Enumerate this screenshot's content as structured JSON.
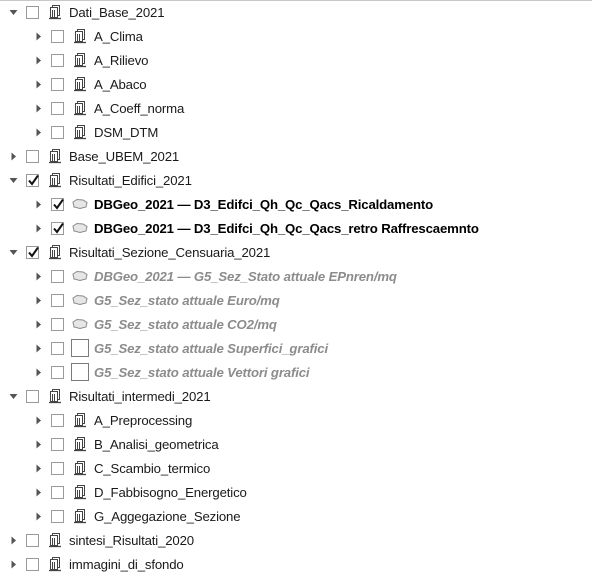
{
  "tree": [
    {
      "label": "Dati_Base_2021",
      "level": 0,
      "expander": "expanded",
      "checked": false,
      "icon": "group-icon",
      "style": "normal"
    },
    {
      "label": "A_Clima",
      "level": 1,
      "expander": "collapsed",
      "checked": false,
      "icon": "group-icon",
      "style": "normal"
    },
    {
      "label": "A_Rilievo",
      "level": 1,
      "expander": "collapsed",
      "checked": false,
      "icon": "group-icon",
      "style": "normal"
    },
    {
      "label": "A_Abaco",
      "level": 1,
      "expander": "collapsed",
      "checked": false,
      "icon": "group-icon",
      "style": "normal"
    },
    {
      "label": "A_Coeff_norma",
      "level": 1,
      "expander": "collapsed",
      "checked": false,
      "icon": "group-icon",
      "style": "normal"
    },
    {
      "label": "DSM_DTM",
      "level": 1,
      "expander": "collapsed",
      "checked": false,
      "icon": "group-icon",
      "style": "normal"
    },
    {
      "label": "Base_UBEM_2021",
      "level": 0,
      "expander": "collapsed",
      "checked": false,
      "icon": "group-icon",
      "style": "normal"
    },
    {
      "label": "Risultati_Edifici_2021",
      "level": 0,
      "expander": "expanded",
      "checked": true,
      "icon": "group-icon",
      "style": "normal"
    },
    {
      "label": "DBGeo_2021 — D3_Edifci_Qh_Qc_Qacs_Ricaldamento",
      "level": 1,
      "expander": "collapsed",
      "checked": true,
      "icon": "polygon-layer-icon",
      "style": "bold"
    },
    {
      "label": "DBGeo_2021 — D3_Edifci_Qh_Qc_Qacs_retro  Raffrescaemnto",
      "level": 1,
      "expander": "collapsed",
      "checked": true,
      "icon": "polygon-layer-icon",
      "style": "bold"
    },
    {
      "label": "Risultati_Sezione_Censuaria_2021",
      "level": 0,
      "expander": "expanded",
      "checked": true,
      "icon": "group-icon",
      "style": "normal"
    },
    {
      "label": "DBGeo_2021 — G5_Sez_Stato attuale EPnren/mq",
      "level": 1,
      "expander": "collapsed",
      "checked": false,
      "icon": "polygon-layer-icon",
      "style": "dim"
    },
    {
      "label": "G5_Sez_stato attuale Euro/mq",
      "level": 1,
      "expander": "collapsed",
      "checked": false,
      "icon": "polygon-layer-icon",
      "style": "dim"
    },
    {
      "label": "G5_Sez_stato attuale  CO2/mq",
      "level": 1,
      "expander": "collapsed",
      "checked": false,
      "icon": "polygon-layer-icon",
      "style": "dim"
    },
    {
      "label": "G5_Sez_stato attuale  Superfici_grafici",
      "level": 1,
      "expander": "collapsed",
      "checked": false,
      "icon": "table-layer-icon",
      "style": "dim"
    },
    {
      "label": "G5_Sez_stato attuale  Vettori grafici",
      "level": 1,
      "expander": "collapsed",
      "checked": false,
      "icon": "table-layer-icon",
      "style": "dim"
    },
    {
      "label": "Risultati_intermedi_2021",
      "level": 0,
      "expander": "expanded",
      "checked": false,
      "icon": "group-icon",
      "style": "normal"
    },
    {
      "label": "A_Preprocessing",
      "level": 1,
      "expander": "collapsed",
      "checked": false,
      "icon": "group-icon",
      "style": "normal"
    },
    {
      "label": "B_Analisi_geometrica",
      "level": 1,
      "expander": "collapsed",
      "checked": false,
      "icon": "group-icon",
      "style": "normal"
    },
    {
      "label": "C_Scambio_termico",
      "level": 1,
      "expander": "collapsed",
      "checked": false,
      "icon": "group-icon",
      "style": "normal"
    },
    {
      "label": "D_Fabbisogno_Energetico",
      "level": 1,
      "expander": "collapsed",
      "checked": false,
      "icon": "group-icon",
      "style": "normal"
    },
    {
      "label": "G_Aggegazione_Sezione",
      "level": 1,
      "expander": "collapsed",
      "checked": false,
      "icon": "group-icon",
      "style": "normal"
    },
    {
      "label": "sintesi_Risultati_2020",
      "level": 0,
      "expander": "collapsed",
      "checked": false,
      "icon": "group-icon",
      "style": "normal"
    },
    {
      "label": "immagini_di_sfondo",
      "level": 0,
      "expander": "collapsed",
      "checked": false,
      "icon": "group-icon",
      "style": "normal"
    }
  ]
}
